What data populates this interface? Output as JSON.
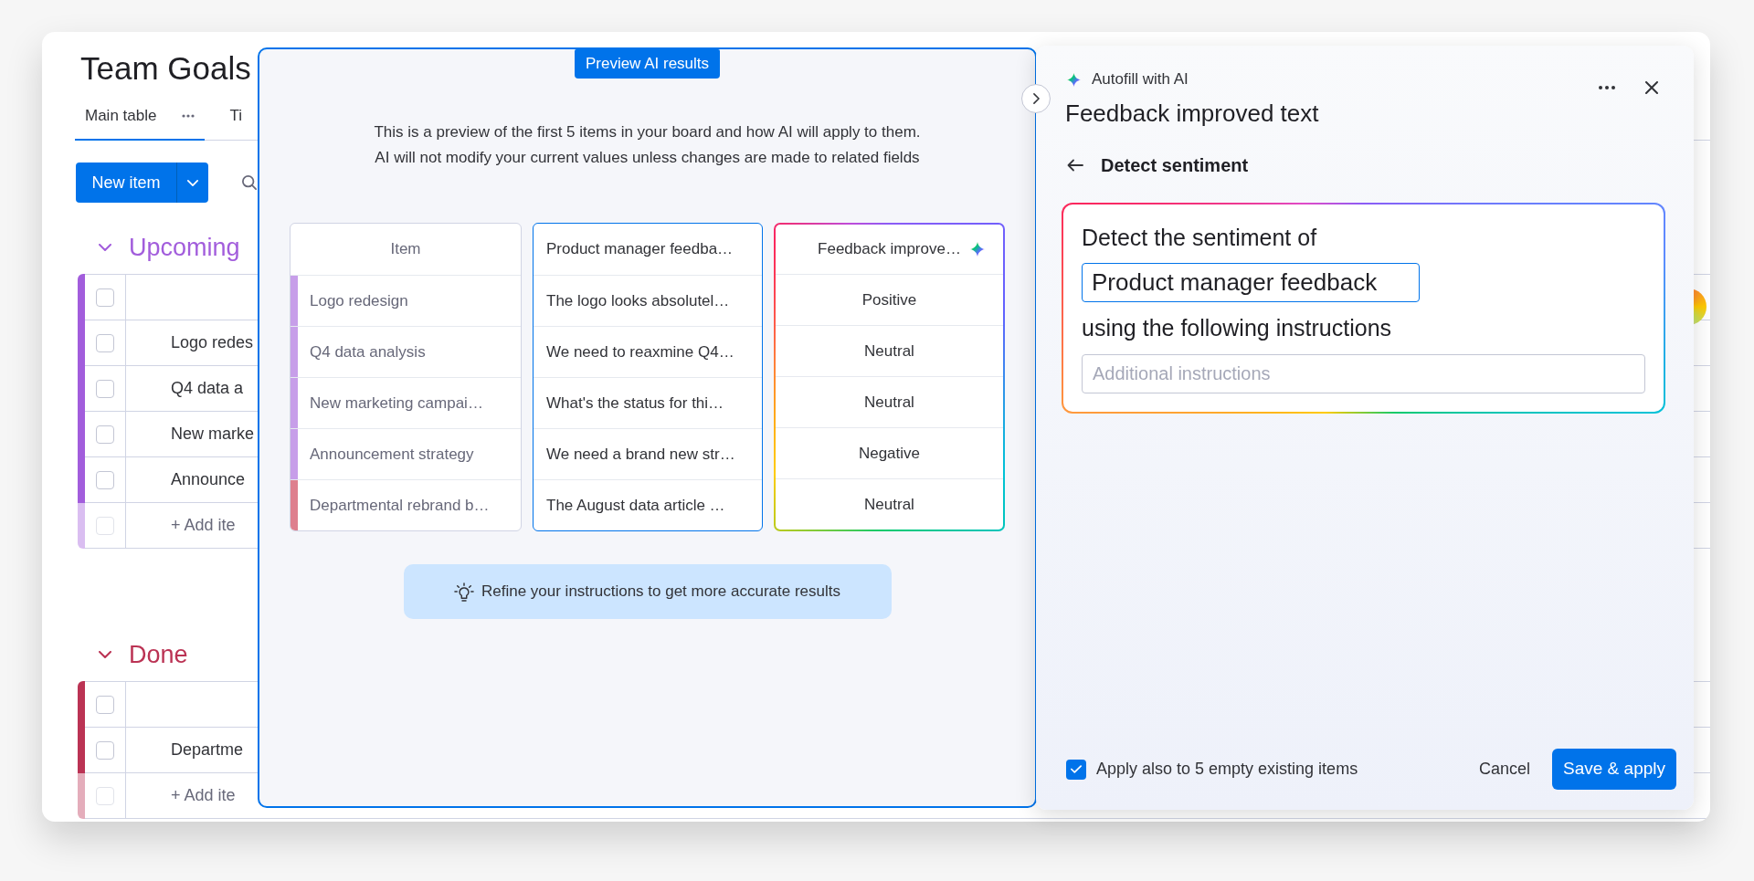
{
  "board": {
    "title": "Team Goals",
    "tabs": [
      {
        "label": "Main table",
        "selected": true
      },
      {
        "label": "Ti",
        "selected": false
      }
    ],
    "new_item": "New item",
    "groups": [
      {
        "title": "Upcoming",
        "color": "#a25ddc",
        "all_checked": false,
        "items": [
          {
            "name": "Logo redes",
            "checked": false
          },
          {
            "name": "Q4 data a",
            "checked": false
          },
          {
            "name": "New marke",
            "checked": false
          },
          {
            "name": "Announce",
            "checked": false
          }
        ],
        "add_item": {
          "label": "+ Add ite",
          "checked": false
        }
      },
      {
        "title": "Done",
        "color": "#bb3354",
        "all_checked": false,
        "items": [
          {
            "name": "Departme",
            "checked": false
          }
        ],
        "add_item": {
          "label": "+ Add ite",
          "checked": false
        }
      }
    ]
  },
  "preview": {
    "badge": "Preview AI results",
    "description": [
      "This is a preview of the first 5 items in your board and how AI will apply to them.",
      "AI will not modify your current values unless changes are made to related fields"
    ],
    "columns": [
      "Item",
      "Product manager feedba…",
      "Feedback improve…"
    ],
    "rows": [
      {
        "item": "Logo redesign",
        "color": "#c79ee9",
        "feedback": "The logo looks absolutel…",
        "sentiment": "Positive"
      },
      {
        "item": "Q4 data analysis",
        "color": "#c79ee9",
        "feedback": "We need to reaxmine Q4…",
        "sentiment": "Neutral"
      },
      {
        "item": "New marketing campai…",
        "color": "#c79ee9",
        "feedback": "What's the status for thi…",
        "sentiment": "Neutral"
      },
      {
        "item": "Announcement strategy",
        "color": "#c79ee9",
        "feedback": "We need a brand new str…",
        "sentiment": "Negative"
      },
      {
        "item": "Departmental rebrand b…",
        "color": "#de7f8e",
        "feedback": "The August data article …",
        "sentiment": "Neutral"
      }
    ],
    "tip": "Refine your instructions to get more accurate results"
  },
  "panel": {
    "eyebrow": "Autofill with AI",
    "title": "Feedback improved text",
    "step": "Detect sentiment",
    "prompt": {
      "lead": "Detect the sentiment of",
      "column": "Product manager feedback",
      "middle": "using the following instructions",
      "placeholder": "Additional instructions"
    },
    "apply": {
      "label": "Apply also to 5 empty existing items",
      "checked": true
    },
    "cancel": "Cancel",
    "save": "Save & apply"
  }
}
